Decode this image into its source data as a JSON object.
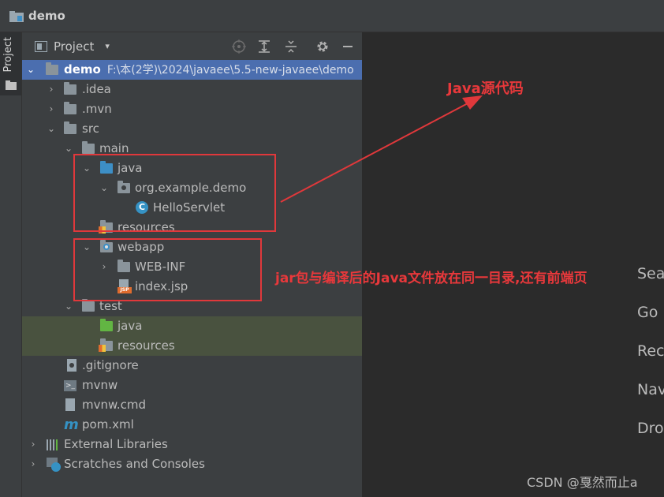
{
  "window": {
    "title": "demo"
  },
  "side_strip": {
    "tab_label": "Project"
  },
  "panel": {
    "title": "Project",
    "dropdown": "▾"
  },
  "tree": {
    "root": {
      "name": "demo",
      "path": "F:\\本(2学)\\2024\\javaee\\5.5-new-javaee\\demo"
    },
    "idea": ".idea",
    "mvn": ".mvn",
    "src": "src",
    "main": "main",
    "java": "java",
    "package": "org.example.demo",
    "class": "HelloServlet",
    "resources": "resources",
    "webapp": "webapp",
    "webinf": "WEB-INF",
    "indexjsp": "index.jsp",
    "test": "test",
    "test_java": "java",
    "test_resources": "resources",
    "gitignore": ".gitignore",
    "mvnw": "mvnw",
    "mvnwcmd": "mvnw.cmd",
    "pom": "pom.xml",
    "external": "External Libraries",
    "scratches": "Scratches and Consoles"
  },
  "icons": {
    "class_letter": "C",
    "jsp_tag": "JSP",
    "term_glyph": ">_",
    "maven_glyph": "m"
  },
  "editor_hints": [
    "Sea",
    "Go",
    "Rec",
    "Nav",
    "Dro"
  ],
  "annotations": {
    "java_source": "Java源代码",
    "webapp_note": "jar包与编译后的Java文件放在同一目录,还有前端页"
  },
  "watermark": "CSDN @戛然而止a",
  "colors": {
    "annotation_red": "#e0383b",
    "selection": "#4b6eaf",
    "test_highlight": "#49523f"
  }
}
